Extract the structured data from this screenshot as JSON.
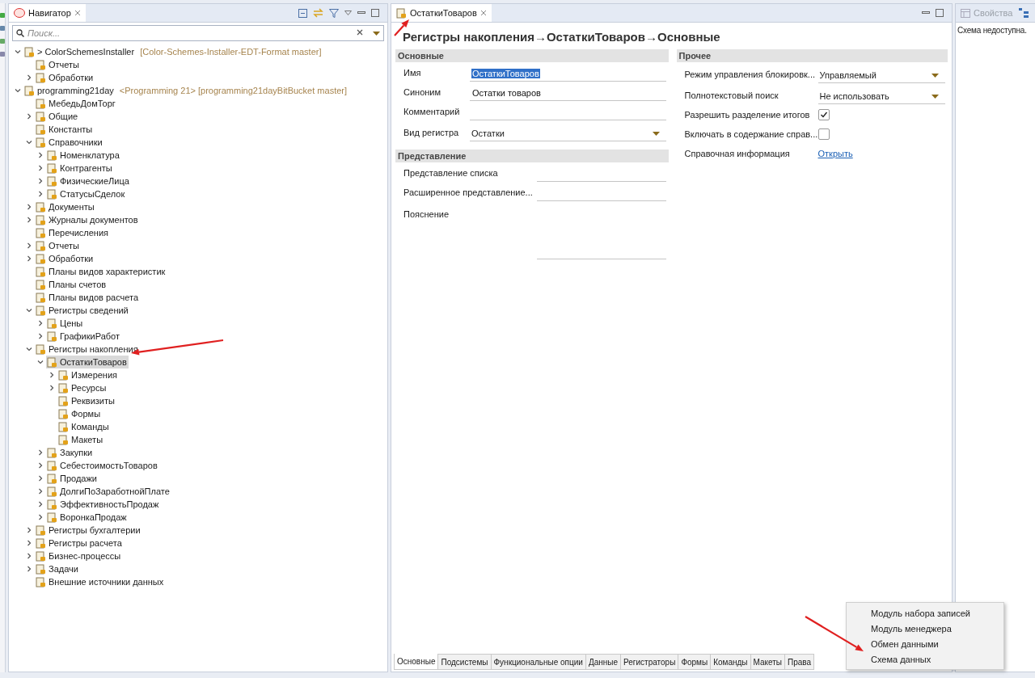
{
  "navigator": {
    "title": "Навигатор",
    "search": {
      "placeholder": "Поиск..."
    },
    "tree": [
      {
        "label": "> ColorSchemesInstaller",
        "decoration": "[Color-Schemes-Installer-EDT-Format master]",
        "kind": "group",
        "expanded": true,
        "selected": false,
        "children": [
          {
            "label": "Отчеты",
            "kind": "leaf",
            "selected": false
          },
          {
            "label": "Обработки",
            "kind": "group",
            "expanded": false,
            "selected": false
          }
        ]
      },
      {
        "label": "programming21day",
        "decoration": "<Programming 21> [programming21dayBitBucket master]",
        "kind": "group",
        "expanded": true,
        "selected": false,
        "children": [
          {
            "label": "МебедьДомТорг",
            "kind": "leaf",
            "selected": false
          },
          {
            "label": "Общие",
            "kind": "group",
            "expanded": false,
            "selected": false
          },
          {
            "label": "Константы",
            "kind": "leaf",
            "selected": false
          },
          {
            "label": "Справочники",
            "kind": "group",
            "expanded": true,
            "selected": false,
            "children": [
              {
                "label": "Номенклатура",
                "kind": "group",
                "expanded": false,
                "selected": false
              },
              {
                "label": "Контрагенты",
                "kind": "group",
                "expanded": false,
                "selected": false
              },
              {
                "label": "ФизическиеЛица",
                "kind": "group",
                "expanded": false,
                "selected": false
              },
              {
                "label": "СтатусыСделок",
                "kind": "group",
                "expanded": false,
                "selected": false
              }
            ]
          },
          {
            "label": "Документы",
            "kind": "group",
            "expanded": false,
            "selected": false
          },
          {
            "label": "Журналы документов",
            "kind": "group",
            "expanded": false,
            "selected": false
          },
          {
            "label": "Перечисления",
            "kind": "leaf",
            "selected": false
          },
          {
            "label": "Отчеты",
            "kind": "group",
            "expanded": false,
            "selected": false
          },
          {
            "label": "Обработки",
            "kind": "group",
            "expanded": false,
            "selected": false
          },
          {
            "label": "Планы видов характеристик",
            "kind": "leaf",
            "selected": false
          },
          {
            "label": "Планы счетов",
            "kind": "leaf",
            "selected": false
          },
          {
            "label": "Планы видов расчета",
            "kind": "leaf",
            "selected": false
          },
          {
            "label": "Регистры сведений",
            "kind": "group",
            "expanded": true,
            "selected": false,
            "children": [
              {
                "label": "Цены",
                "kind": "group",
                "expanded": false,
                "selected": false
              },
              {
                "label": "ГрафикиРабот",
                "kind": "group",
                "expanded": false,
                "selected": false
              }
            ]
          },
          {
            "label": "Регистры накопления",
            "kind": "group",
            "expanded": true,
            "selected": false,
            "children": [
              {
                "label": "ОстаткиТоваров",
                "kind": "group",
                "expanded": true,
                "selected": true,
                "children": [
                  {
                    "label": "Измерения",
                    "kind": "group",
                    "expanded": false,
                    "selected": false
                  },
                  {
                    "label": "Ресурсы",
                    "kind": "group",
                    "expanded": false,
                    "selected": false
                  },
                  {
                    "label": "Реквизиты",
                    "kind": "leaf",
                    "selected": false
                  },
                  {
                    "label": "Формы",
                    "kind": "leaf",
                    "selected": false
                  },
                  {
                    "label": "Команды",
                    "kind": "leaf",
                    "selected": false
                  },
                  {
                    "label": "Макеты",
                    "kind": "leaf",
                    "selected": false
                  }
                ]
              },
              {
                "label": "Закупки",
                "kind": "group",
                "expanded": false,
                "selected": false
              },
              {
                "label": "СебестоимостьТоваров",
                "kind": "group",
                "expanded": false,
                "selected": false
              },
              {
                "label": "Продажи",
                "kind": "group",
                "expanded": false,
                "selected": false
              },
              {
                "label": "ДолгиПоЗаработнойПлате",
                "kind": "group",
                "expanded": false,
                "selected": false
              },
              {
                "label": "ЭффективностьПродаж",
                "kind": "group",
                "expanded": false,
                "selected": false
              },
              {
                "label": "ВоронкаПродаж",
                "kind": "group",
                "expanded": false,
                "selected": false
              }
            ]
          },
          {
            "label": "Регистры бухгалтерии",
            "kind": "group",
            "expanded": false,
            "selected": false
          },
          {
            "label": "Регистры расчета",
            "kind": "group",
            "expanded": false,
            "selected": false
          },
          {
            "label": "Бизнес-процессы",
            "kind": "group",
            "expanded": false,
            "selected": false
          },
          {
            "label": "Задачи",
            "kind": "group",
            "expanded": false,
            "selected": false
          },
          {
            "label": "Внешние источники данных",
            "kind": "leaf",
            "selected": false
          }
        ]
      }
    ]
  },
  "editor": {
    "tab": {
      "label": "ОстаткиТоваров"
    },
    "breadcrumb": "Регистры накопления→ОстаткиТоваров→Основные",
    "columns": [
      {
        "sections": [
          {
            "title": "Основные",
            "fields": [
              {
                "kind": "text",
                "label": "Имя",
                "value": "ОстаткиТоваров",
                "text_selected": true
              },
              {
                "kind": "text",
                "label": "Синоним",
                "value": "Остатки товаров",
                "text_selected": false
              },
              {
                "kind": "text",
                "label": "Комментарий"
              },
              {
                "kind": "select",
                "label": "Вид регистра",
                "value": "Остатки"
              }
            ]
          },
          {
            "title": "Представление",
            "fields": [
              {
                "kind": "text",
                "label": "Представление списка"
              },
              {
                "kind": "text",
                "label": "Расширенное представление..."
              },
              {
                "kind": "multiline",
                "label": "Пояснение"
              }
            ]
          }
        ]
      },
      {
        "sections": [
          {
            "title": "Прочее",
            "fields": [
              {
                "kind": "select",
                "label": "Режим управления блокировк...",
                "value": "Управляемый"
              },
              {
                "kind": "select",
                "label": "Полнотекстовый поиск",
                "value": "Не использовать"
              },
              {
                "kind": "checkbox",
                "label": "Разрешить разделение итогов",
                "checked": true
              },
              {
                "kind": "checkbox",
                "label": "Включать в содержание справ...",
                "checked": false
              },
              {
                "kind": "link",
                "label": "Справочная информация",
                "value": "Открыть"
              }
            ]
          }
        ]
      }
    ],
    "bottom_tabs": [
      {
        "label": "Основные",
        "selected": true
      },
      {
        "label": "Подсистемы",
        "selected": false
      },
      {
        "label": "Функциональные опции",
        "selected": false
      },
      {
        "label": "Данные",
        "selected": false
      },
      {
        "label": "Регистраторы",
        "selected": false
      },
      {
        "label": "Формы",
        "selected": false
      },
      {
        "label": "Команды",
        "selected": false
      },
      {
        "label": "Макеты",
        "selected": false
      },
      {
        "label": "Права",
        "selected": false
      }
    ],
    "popup_menu": [
      "Модуль набора записей",
      "Модуль менеджера",
      "Обмен данными",
      "Схема данных"
    ]
  },
  "properties": {
    "tabs": [
      {
        "label": "Свойства",
        "selected": false
      }
    ],
    "message": "Схема недоступна."
  }
}
